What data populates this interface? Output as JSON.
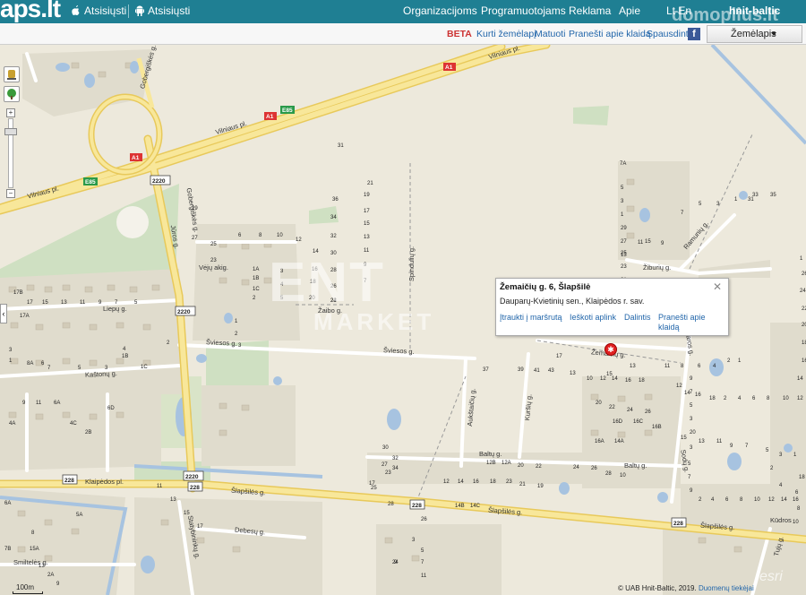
{
  "header": {
    "logo": "aps.lt",
    "apps": [
      {
        "label": "Atsisiųsti",
        "icon": "apple-icon"
      },
      {
        "label": "Atsisiųsti",
        "icon": "android-icon"
      }
    ],
    "nav": [
      "Organizacijoms",
      "Programuotojams",
      "Reklama",
      "Apie"
    ],
    "lang": "Lt  En",
    "brand": "hnit-baltic"
  },
  "toolbar": {
    "beta": "BETA",
    "links": [
      "Kurti žemėlapį",
      "Matuoti",
      "Pranešti apie klaidą",
      "Spausdinti"
    ],
    "map_type": "Žemėlapis"
  },
  "popup": {
    "title": "Žemaičių g. 6, Šlapšilė",
    "address": "Dauparų-Kvietinių sen., Klaipėdos r. sav.",
    "links": [
      "Įtraukti į maršrutą",
      "Ieškoti aplink",
      "Dalintis",
      "Pranešti apie klaidą"
    ]
  },
  "map": {
    "streets": [
      "Vilniaus pl.",
      "Vilniaus pl.",
      "Vilniaus pl.",
      "Gobergiškės g.",
      "Liepų g.",
      "Vėjų akig.",
      "Žaibo g.",
      "Šviesos g.",
      "Šviesos g.",
      "Kaštonų g.",
      "Gobergiškės g.",
      "Klaipėdos pl.",
      "Šlapšilės g.",
      "Šlapšilės g.",
      "Šlapšilės g.",
      "Statybininkų g.",
      "Debesų g.",
      "Smiltelės g.",
      "Baltų g.",
      "Baltų g.",
      "Aukštaičių g.",
      "Kuršių g.",
      "Žemaičių g.",
      "Ramunių g.",
      "Žiburių g.",
      "Kūdros",
      "Tujų g.",
      "Sodų g.",
      "Spindulių g.",
      "Vasaros g.",
      "Jūros g."
    ],
    "road_numbers": [
      "A1",
      "A1",
      "A1",
      "E85",
      "E85",
      "2220",
      "2220",
      "2220",
      "228",
      "228",
      "228",
      "228"
    ],
    "house_numbers": [
      "31",
      "21",
      "19",
      "17",
      "15",
      "13",
      "11",
      "9",
      "7",
      "36",
      "34",
      "32",
      "30",
      "28",
      "26",
      "24",
      "22",
      "20",
      "29",
      "27",
      "25",
      "23",
      "6",
      "8",
      "10",
      "12",
      "14",
      "16",
      "18",
      "1A",
      "1B",
      "1C",
      "2",
      "3",
      "4",
      "5",
      "1",
      "2",
      "3",
      "17B",
      "17A",
      "17",
      "15",
      "13",
      "11",
      "9",
      "7",
      "5",
      "3",
      "1",
      "8A",
      "6",
      "4",
      "2",
      "1B",
      "1C",
      "3",
      "5",
      "7",
      "9",
      "11",
      "6A",
      "6D",
      "4C",
      "2B",
      "4A",
      "6A",
      "8",
      "7B",
      "5A",
      "15A",
      "13",
      "2A",
      "9",
      "7A",
      "5",
      "3",
      "1",
      "29",
      "27",
      "25",
      "23",
      "21",
      "19",
      "17",
      "15",
      "13",
      "11",
      "9",
      "7",
      "5",
      "3",
      "1",
      "31",
      "33",
      "35",
      "37",
      "39",
      "41",
      "43",
      "13",
      "10",
      "12",
      "14",
      "16",
      "18",
      "20",
      "22",
      "24",
      "26",
      "16D",
      "16C",
      "16B",
      "16A",
      "14A",
      "14B",
      "14C",
      "12B",
      "12A",
      "20",
      "22",
      "24",
      "26",
      "28",
      "10",
      "12",
      "14",
      "16",
      "18",
      "23",
      "21",
      "19",
      "17",
      "15",
      "13",
      "11",
      "8",
      "6",
      "4",
      "2",
      "1",
      "3",
      "5",
      "7",
      "9",
      "11",
      "24",
      "26",
      "28",
      "23",
      "25",
      "27",
      "34",
      "32",
      "30",
      "17",
      "15",
      "13",
      "11",
      "9",
      "7",
      "5",
      "3",
      "1",
      "2",
      "4",
      "6",
      "8",
      "10",
      "12",
      "14",
      "16",
      "18",
      "2",
      "4",
      "6",
      "8",
      "10",
      "12",
      "14",
      "16",
      "18",
      "20",
      "22",
      "24",
      "26",
      "1",
      "3",
      "5",
      "7",
      "9",
      "2",
      "4",
      "6",
      "8",
      "10",
      "12",
      "14",
      "16",
      "18",
      "20",
      "3",
      "5",
      "7",
      "9",
      "11",
      "13",
      "15",
      "17"
    ]
  },
  "scale_label": "100m",
  "copyright": "© UAB Hnit-Baltic, 2019.",
  "copyright_link": "Duomenų tiekėjai",
  "watermarks": {
    "top": "domoplius.lt",
    "mid": "ENT",
    "mid2": "MARKET",
    "bottom": "esri"
  }
}
